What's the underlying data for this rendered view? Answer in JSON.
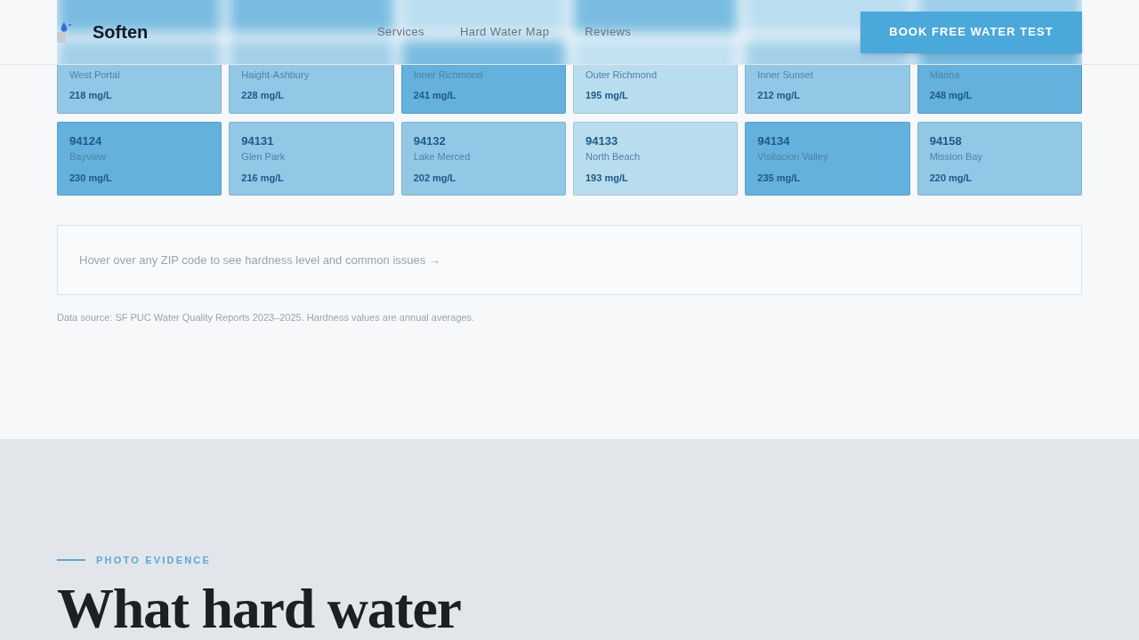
{
  "header": {
    "brand": "Soften",
    "nav": [
      {
        "label": "Services"
      },
      {
        "label": "Hard Water Map"
      },
      {
        "label": "Reviews"
      }
    ],
    "cta": "BOOK FREE WATER TEST"
  },
  "zip_grid": {
    "cards": [
      {
        "name": "West Portal",
        "reading": "218 mg/L",
        "color": "#92c8e6"
      },
      {
        "name": "Haight-Ashbury",
        "reading": "228 mg/L",
        "color": "#92c8e6"
      },
      {
        "name": "Inner Richmond",
        "reading": "241 mg/L",
        "color": "#63b1dc"
      },
      {
        "name": "Outer Richmond",
        "reading": "195 mg/L",
        "color": "#b8ddef"
      },
      {
        "name": "Inner Sunset",
        "reading": "212 mg/L",
        "color": "#92c8e6"
      },
      {
        "name": "Marina",
        "reading": "248 mg/L",
        "color": "#63b1dc"
      },
      {
        "zip": "94124",
        "name": "Bayview",
        "reading": "230 mg/L",
        "color": "#63b1dc"
      },
      {
        "zip": "94131",
        "name": "Glen Park",
        "reading": "216 mg/L",
        "color": "#92c8e6"
      },
      {
        "zip": "94132",
        "name": "Lake Merced",
        "reading": "202 mg/L",
        "color": "#92c8e6"
      },
      {
        "zip": "94133",
        "name": "North Beach",
        "reading": "193 mg/L",
        "color": "#b8ddef"
      },
      {
        "zip": "94134",
        "name": "Visitacion Valley",
        "reading": "235 mg/L",
        "color": "#63b1dc"
      },
      {
        "zip": "94158",
        "name": "Mission Bay",
        "reading": "220 mg/L",
        "color": "#92c8e6"
      }
    ]
  },
  "hint": "Hover over any ZIP code to see hardness level and common issues →",
  "source_note": "Data source: SF PUC Water Quality Reports 2023–2025. Hardness values are annual averages.",
  "photo_section": {
    "eyebrow": "PHOTO EVIDENCE",
    "heading": "What hard water"
  }
}
